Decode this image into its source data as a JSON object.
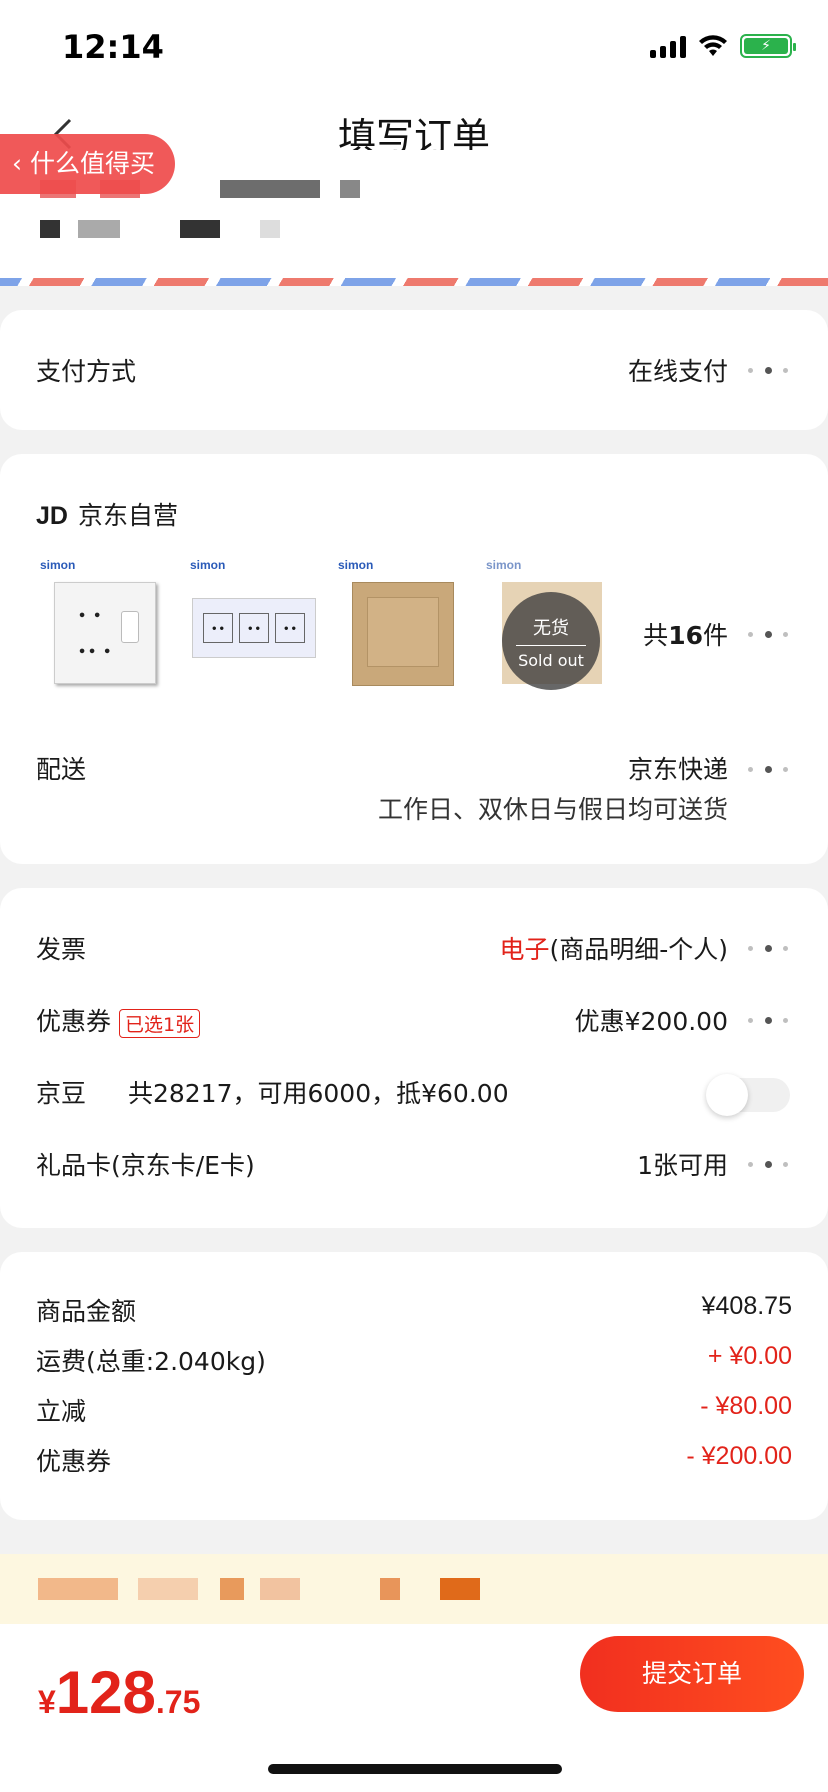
{
  "status_bar": {
    "time": "12:14"
  },
  "nav": {
    "title": "填写订单",
    "smzdm_tag": "什么值得买"
  },
  "payment": {
    "label": "支付方式",
    "value": "在线支付"
  },
  "store": {
    "logo": "JD",
    "name": "京东自营",
    "brand": "simon",
    "count_prefix": "共",
    "count": "16",
    "count_suffix": "件",
    "sold_out_cn": "无货",
    "sold_out_en": "Sold out"
  },
  "delivery": {
    "label": "配送",
    "method": "京东快递",
    "note": "工作日、双休日与假日均可送货"
  },
  "invoice": {
    "label": "发票",
    "type": "电子",
    "detail": "(商品明细-个人)"
  },
  "coupon": {
    "label": "优惠券",
    "badge": "已选1张",
    "value": "优惠¥200.00"
  },
  "jingdou": {
    "label": "京豆",
    "detail": "共28217，可用6000，抵¥60.00",
    "enabled": false
  },
  "giftcard": {
    "label": "礼品卡(京东卡/E卡)",
    "value": "1张可用"
  },
  "summary": [
    {
      "label": "商品金额",
      "value": "¥408.75",
      "color": "#1a1a1a"
    },
    {
      "label": "运费(总重:2.040kg)",
      "value": "+ ¥0.00",
      "color": "#e2231a"
    },
    {
      "label": "立减",
      "value": "- ¥80.00",
      "color": "#e2231a"
    },
    {
      "label": "优惠券",
      "value": "- ¥200.00",
      "color": "#e2231a"
    }
  ],
  "total": {
    "currency": "¥",
    "integer": "128",
    "decimal": ".75"
  },
  "submit": {
    "label": "提交订单"
  },
  "colors": {
    "accent": "#e2231a",
    "button": "#f12f1f"
  }
}
